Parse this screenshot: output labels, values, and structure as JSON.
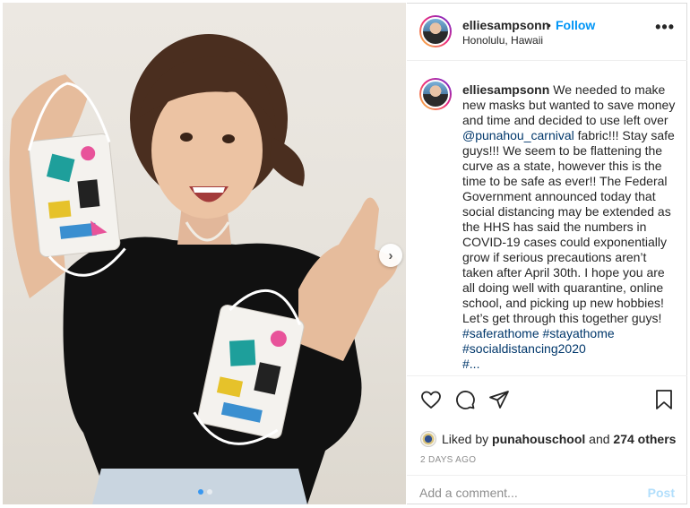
{
  "header": {
    "username": "elliesampsonn",
    "separator": "•",
    "follow_label": "Follow",
    "location": "Honolulu, Hawaii",
    "more_label": "•••"
  },
  "caption": {
    "username": "elliesampsonn",
    "text_1": "We needed to make new masks but wanted to save money and time and decided to use left over ",
    "mention": "@punahou_carnival",
    "text_2": " fabric!!! Stay safe guys!!! We seem to be flattening the curve as a state, however this is the time to be safe as ever!! The Federal Government announced today that social distancing may be extended as the HHS has said the numbers in COVID-19 cases could exponentially grow if serious precautions aren’t taken after April 30th. I hope you are all doing well with quarantine, online school, and picking up new hobbies! Let’s get through this together guys!",
    "hashtags": [
      "#saferathome",
      "#stayathome",
      "#socialdistancing2020",
      "#..."
    ]
  },
  "likes": {
    "prefix": "Liked by",
    "liker": "punahouschool",
    "middle": "and",
    "others": "274 others"
  },
  "timestamp": "2 DAYS AGO",
  "comment": {
    "placeholder": "Add a comment...",
    "post_label": "Post"
  },
  "carousel": {
    "slide_count": 2,
    "active_index": 0,
    "next_label": "›"
  },
  "colors": {
    "follow_blue": "#0095f6",
    "link_blue": "#00376b",
    "post_disabled": "#b2dffc",
    "muted": "#8e8e8e",
    "border": "#dbdbdb"
  },
  "icons": [
    "heart-icon",
    "comment-icon",
    "share-icon",
    "bookmark-icon",
    "chevron-right-icon",
    "more-icon"
  ]
}
